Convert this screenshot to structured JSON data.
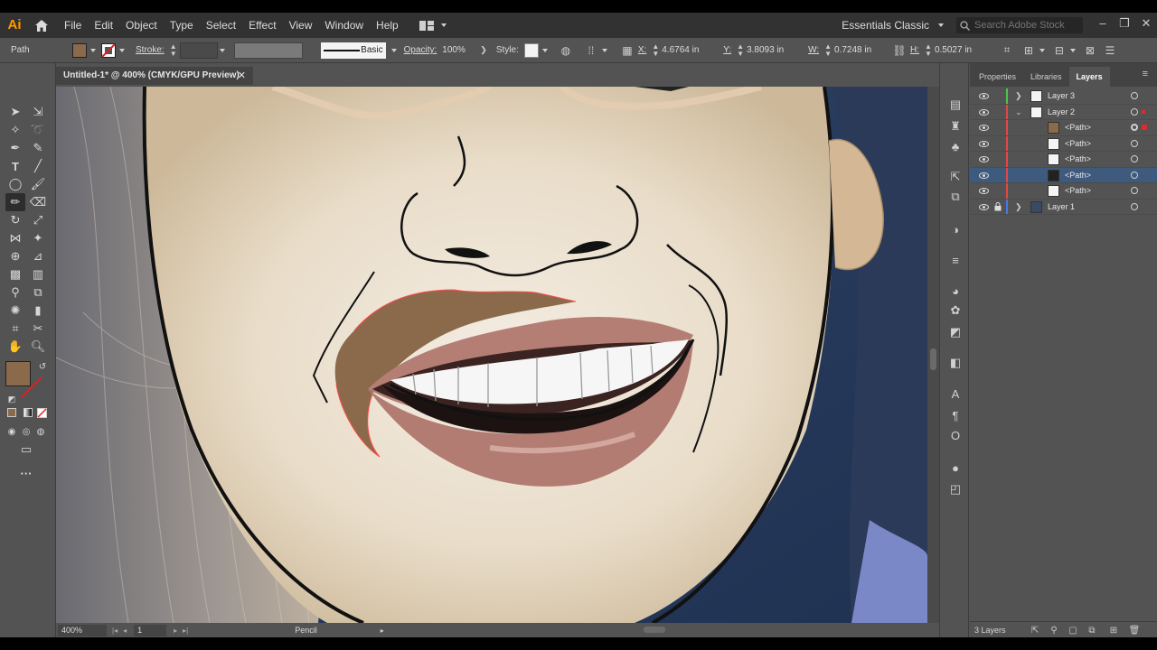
{
  "app": {
    "logo": "Ai"
  },
  "menu": [
    "File",
    "Edit",
    "Object",
    "Type",
    "Select",
    "Effect",
    "View",
    "Window",
    "Help"
  ],
  "workspace": "Essentials Classic",
  "stock_search": {
    "placeholder": "Search Adobe Stock"
  },
  "control_bar": {
    "selection": "Path",
    "fill_color": "#8b6a4b",
    "stroke_label": "Stroke:",
    "brush_label": "Basic",
    "opacity_label": "Opacity:",
    "opacity_value": "100%",
    "style_label": "Style:",
    "x_label": "X:",
    "x_value": "4.6764 in",
    "y_label": "Y:",
    "y_value": "3.8093 in",
    "w_label": "W:",
    "w_value": "0.7248 in",
    "h_label": "H:",
    "h_value": "0.5027 in"
  },
  "document": {
    "tab_title": "Untitled-1* @ 400% (CMYK/GPU Preview)"
  },
  "status": {
    "zoom": "400%",
    "artboard": "1",
    "tool": "Pencil"
  },
  "panel": {
    "tabs": [
      "Properties",
      "Libraries",
      "Layers"
    ],
    "active_tab": "Layers",
    "layers": [
      {
        "name": "Layer 3",
        "color": "#4fc24f"
      },
      {
        "name": "Layer 2",
        "color": "#e04848"
      },
      {
        "name": "<Path>"
      },
      {
        "name": "<Path>"
      },
      {
        "name": "<Path>"
      },
      {
        "name": "<Path>",
        "selected": true
      },
      {
        "name": "<Path>"
      },
      {
        "name": "Layer 1",
        "color": "#4878e0"
      }
    ],
    "count": "3 Layers"
  },
  "colors": {
    "fill_swatch": "#8b6a4b",
    "selection_highlight": "#3e5a7c",
    "path_selection": "#ff4a4a"
  }
}
